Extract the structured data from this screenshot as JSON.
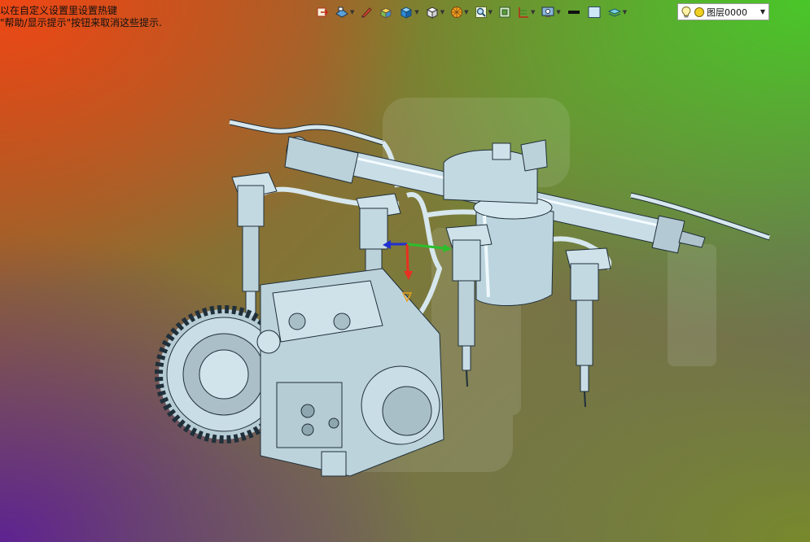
{
  "hint": {
    "line1": "以在自定义设置里设置热键",
    "line2": "\"帮助/显示提示\"按钮来取消这些提示."
  },
  "toolbar": {
    "buttons": [
      {
        "icon": "assembly-icon"
      },
      {
        "icon": "views-icon"
      },
      {
        "icon": "pen-icon"
      },
      {
        "icon": "shade-box-icon"
      },
      {
        "icon": "cube-icon"
      },
      {
        "icon": "wire-cube-icon"
      },
      {
        "icon": "render-sphere-icon"
      },
      {
        "icon": "zoom-icon"
      },
      {
        "icon": "frame-icon"
      },
      {
        "icon": "grid-icon"
      },
      {
        "icon": "display-icon"
      },
      {
        "icon": "line-style-icon"
      },
      {
        "icon": "color-box-icon"
      },
      {
        "icon": "layer-props-icon"
      }
    ]
  },
  "layer": {
    "bulb_icon": "lightbulb-icon",
    "status_icon": "layer-dot-icon",
    "value": "图层0000"
  },
  "colors": {
    "part_fill": "#c8dde6",
    "part_edge": "#20303a",
    "axis_x": "#2bbf2b",
    "axis_y": "#e83020",
    "axis_z": "#2030d0"
  }
}
